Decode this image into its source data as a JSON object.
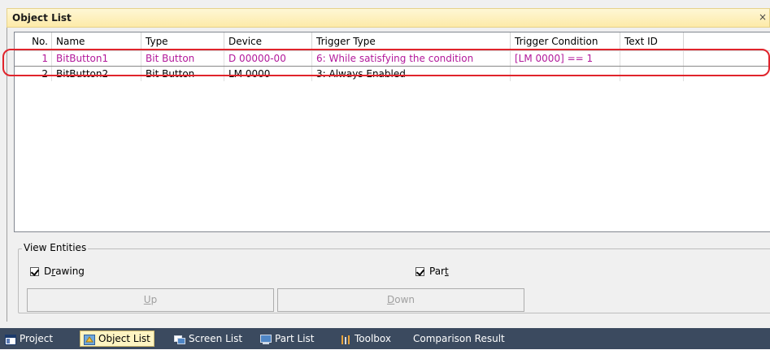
{
  "window": {
    "title": "Object List",
    "close": "×"
  },
  "columns": [
    "No.",
    "Name",
    "Type",
    "Device",
    "Trigger Type",
    "Trigger Condition",
    "Text ID"
  ],
  "rows": [
    {
      "no": "1",
      "name": "BitButton1",
      "type": "Bit Button",
      "device": "D 00000-00",
      "trigger_type": "6: While satisfying the condition",
      "trigger_condition": "[LM 0000] == 1",
      "text_id": ""
    },
    {
      "no": "2",
      "name": "BitButton2",
      "type": "Bit Button",
      "device": "LM 0000",
      "trigger_type": "3: Always Enabled",
      "trigger_condition": "",
      "text_id": ""
    }
  ],
  "view_entities": {
    "label": "View Entities",
    "drawing": {
      "label_pre": "D",
      "label_underline": "r",
      "label_post": "awing",
      "checked": true
    },
    "part": {
      "label_pre": "Par",
      "label_underline": "t",
      "label_post": "",
      "checked": true
    }
  },
  "buttons": {
    "up": {
      "underline": "U",
      "rest": "p"
    },
    "down": {
      "underline": "D",
      "rest": "own"
    }
  },
  "tabs": [
    {
      "label": "Project",
      "icon": "project-icon",
      "active": false
    },
    {
      "label": "Object List",
      "icon": "object-list-icon",
      "active": true
    },
    {
      "label": "Screen List",
      "icon": "screen-list-icon",
      "active": false
    },
    {
      "label": "Part List",
      "icon": "part-list-icon",
      "active": false
    },
    {
      "label": "Toolbox",
      "icon": "toolbox-icon",
      "active": false
    },
    {
      "label": "Comparison Result",
      "icon": "",
      "active": false
    }
  ],
  "colors": {
    "selected_text": "#b2199b",
    "highlight_border": "#e0242c",
    "tabbar_bg": "#3b4a5f",
    "title_bg": "#fdeaa8"
  }
}
